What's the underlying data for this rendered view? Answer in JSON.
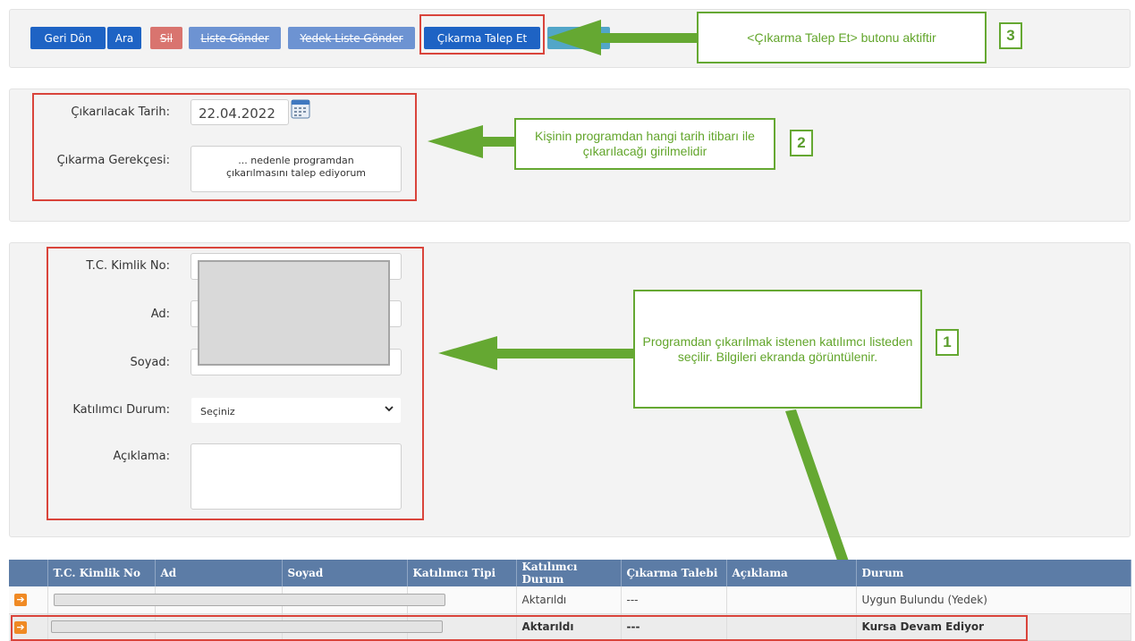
{
  "toolbar": {
    "buttons": {
      "back": "Geri Dön",
      "search": "Ara",
      "delete": "Sil",
      "send_list": "Liste Gönder",
      "send_backup_list": "Yedek Liste Gönder",
      "request_removal": "Çıkarma Talep Et"
    }
  },
  "removal_form": {
    "date_label": "Çıkarılacak Tarih:",
    "date_value": "22.04.2022",
    "reason_label": "Çıkarma Gerekçesi:",
    "reason_value": "... nedenle programdan çıkarılmasını talep ediyorum"
  },
  "person_form": {
    "tc_label": "T.C. Kimlik No:",
    "name_label": "Ad:",
    "surname_label": "Soyad:",
    "status_label": "Katılımcı Durum:",
    "status_value": "Seçiniz",
    "note_label": "Açıklama:"
  },
  "callouts": {
    "c3": "<Çıkarma Talep Et> butonu aktiftir",
    "c3_num": "3",
    "c2": "Kişinin programdan hangi tarih itibarı ile çıkarılacağı girilmelidir",
    "c2_num": "2",
    "c1": "Programdan çıkarılmak istenen katılımcı listeden seçilir. Bilgileri ekranda görüntülenir.",
    "c1_num": "1"
  },
  "table": {
    "headers": [
      "T.C. Kimlik No",
      "Ad",
      "Soyad",
      "Katılımcı Tipi",
      "Katılımcı Durum",
      "Çıkarma Talebi",
      "Açıklama",
      "Durum"
    ],
    "rows": [
      {
        "katilimci_durum": "Aktarıldı",
        "cikarma_talebi": "---",
        "durum": "Uygun Bulundu (Yedek)"
      },
      {
        "katilimci_durum": "Aktarıldı",
        "cikarma_talebi": "---",
        "durum": "Kursa Devam Ediyor"
      }
    ]
  },
  "colors": {
    "accent_green": "#65a832",
    "highlight_red": "#d9443b",
    "button_blue": "#1e63c4",
    "table_header": "#5c7ca6"
  }
}
